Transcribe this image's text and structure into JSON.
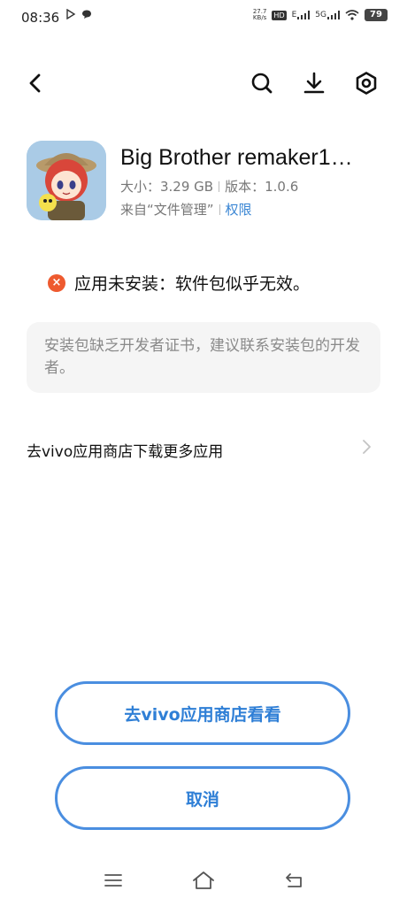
{
  "status_bar": {
    "time": "08:36",
    "net_speed_top": "27.7",
    "net_speed_bottom": "KB/s",
    "hd_label": "HD",
    "sig1_label": "E",
    "sig2_label": "5G",
    "battery": "79"
  },
  "app": {
    "name": "Big Brother remaker1…",
    "size": "大小：3.29 GB",
    "version": "版本：1.0.6",
    "source": "来自“文件管理”",
    "permissions_link": "权限"
  },
  "error": {
    "icon": "×",
    "title": "应用未安装：软件包似乎无效。",
    "reason": "安装包缺乏开发者证书，建议联系安装包的开发者。"
  },
  "store_link": {
    "label": "去vivo应用商店下载更多应用"
  },
  "buttons": {
    "store": "去vivo应用商店看看",
    "cancel": "取消"
  },
  "colors": {
    "accent": "#3a86d4",
    "error": "#ee5a2f"
  }
}
